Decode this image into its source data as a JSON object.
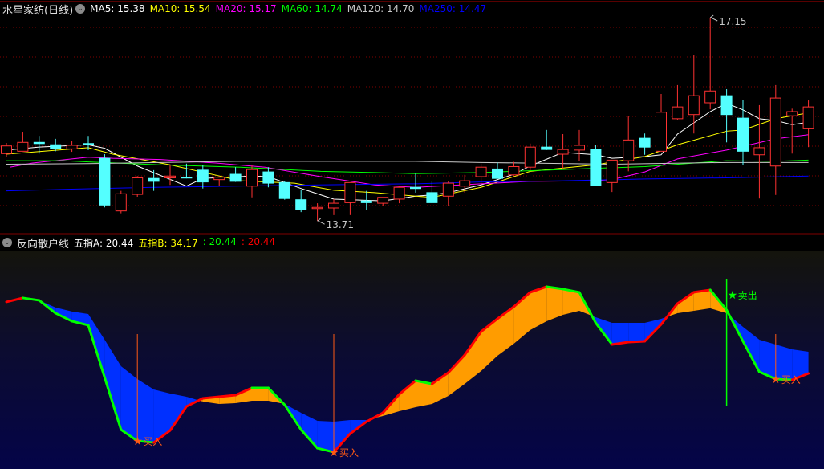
{
  "main_header": {
    "stock_name": "水星家纺(日线)",
    "menu_icon": "chevron-down-circle-icon",
    "ma": [
      {
        "label": "MA5: 15.38",
        "color": "#ffffff"
      },
      {
        "label": "MA10: 15.54",
        "color": "#ffff00"
      },
      {
        "label": "MA20: 15.17",
        "color": "#ff00ff"
      },
      {
        "label": "MA60: 14.74",
        "color": "#00ff00"
      },
      {
        "label": "MA120: 14.70",
        "color": "#c8c8c8"
      },
      {
        "label": "MA250: 14.47",
        "color": "#0000ff"
      }
    ]
  },
  "indicator_header": {
    "menu_icon": "chevron-down-circle-icon",
    "name": "反向散户线",
    "values": [
      {
        "label": "五指A: 20.44",
        "color": "#ffffff"
      },
      {
        "label": "五指B: 34.17",
        "color": "#ffff00"
      },
      {
        "label": ": 20.44",
        "color": "#00ff00"
      },
      {
        "label": ": 20.44",
        "color": "#ff0000"
      }
    ]
  },
  "colors": {
    "up": "#ff3232",
    "down": "#54ffff",
    "grid": "#800000",
    "bull_fill": "#ff9c00",
    "bear_fill": "#0030ff",
    "buy": "#ff5a14",
    "sell": "#00ff00"
  },
  "chart_data": [
    {
      "type": "candlestick",
      "title": "水星家纺(日线)",
      "ohlc": [
        [
          14.85,
          15.03,
          14.8,
          14.98
        ],
        [
          14.89,
          15.22,
          14.89,
          15.04
        ],
        [
          15.04,
          15.15,
          14.85,
          15.02
        ],
        [
          15.0,
          15.1,
          14.89,
          14.93
        ],
        [
          14.93,
          15.06,
          14.88,
          14.99
        ],
        [
          15.02,
          15.15,
          14.91,
          15.0
        ],
        [
          14.77,
          14.84,
          13.94,
          13.98
        ],
        [
          13.88,
          14.22,
          13.84,
          14.17
        ],
        [
          14.16,
          14.47,
          14.12,
          14.44
        ],
        [
          14.43,
          14.57,
          14.22,
          14.38
        ],
        [
          14.44,
          14.65,
          14.32,
          14.47
        ],
        [
          14.45,
          14.68,
          14.43,
          14.44
        ],
        [
          14.57,
          14.66,
          14.26,
          14.37
        ],
        [
          14.41,
          14.47,
          14.31,
          14.45
        ],
        [
          14.5,
          14.62,
          14.37,
          14.38
        ],
        [
          14.3,
          14.65,
          14.11,
          14.58
        ],
        [
          14.54,
          14.62,
          14.28,
          14.35
        ],
        [
          14.36,
          14.39,
          14.07,
          14.09
        ],
        [
          14.07,
          14.23,
          13.86,
          13.9
        ],
        [
          13.92,
          14.01,
          13.71,
          13.94
        ],
        [
          13.93,
          14.08,
          13.81,
          14.01
        ],
        [
          14.02,
          14.36,
          13.81,
          14.36
        ],
        [
          14.05,
          14.22,
          13.89,
          14.02
        ],
        [
          14.01,
          14.11,
          13.96,
          14.11
        ],
        [
          14.08,
          14.3,
          14.01,
          14.28
        ],
        [
          14.28,
          14.51,
          14.19,
          14.26
        ],
        [
          14.19,
          14.39,
          14.01,
          14.02
        ],
        [
          14.13,
          14.39,
          13.96,
          14.35
        ],
        [
          14.3,
          14.49,
          14.19,
          14.39
        ],
        [
          14.46,
          14.68,
          14.31,
          14.62
        ],
        [
          14.59,
          14.7,
          14.43,
          14.43
        ],
        [
          14.49,
          14.71,
          14.48,
          14.63
        ],
        [
          14.62,
          15.02,
          14.57,
          14.96
        ],
        [
          14.96,
          15.25,
          14.91,
          14.92
        ],
        [
          14.84,
          15.18,
          14.6,
          14.92
        ],
        [
          14.91,
          15.25,
          14.73,
          14.99
        ],
        [
          14.92,
          15.0,
          14.31,
          14.31
        ],
        [
          14.36,
          14.74,
          14.2,
          14.74
        ],
        [
          14.73,
          15.48,
          14.55,
          15.08
        ],
        [
          15.11,
          15.19,
          14.83,
          14.96
        ],
        [
          14.89,
          15.86,
          14.89,
          15.55
        ],
        [
          15.44,
          16.01,
          15.42,
          15.64
        ],
        [
          15.51,
          16.52,
          15.19,
          15.83
        ],
        [
          15.71,
          17.15,
          15.6,
          15.91
        ],
        [
          15.83,
          15.94,
          15.04,
          15.51
        ],
        [
          15.45,
          15.75,
          14.66,
          14.89
        ],
        [
          14.83,
          15.67,
          14.09,
          14.95
        ],
        [
          14.64,
          16.01,
          14.15,
          15.79
        ],
        [
          15.49,
          15.61,
          14.85,
          15.56
        ],
        [
          15.27,
          15.75,
          14.96,
          15.64
        ]
      ],
      "ma_series": [
        {
          "name": "MA5",
          "color": "#ffffff",
          "points": [
            [
              1,
              14.91
            ],
            [
              3,
              14.96
            ],
            [
              6,
              15.0
            ],
            [
              7,
              14.94
            ],
            [
              9,
              14.64
            ],
            [
              12,
              14.3
            ],
            [
              13,
              14.43
            ],
            [
              16,
              14.47
            ],
            [
              17,
              14.46
            ],
            [
              19,
              14.26
            ],
            [
              21,
              14.08
            ],
            [
              24,
              14.05
            ],
            [
              26,
              14.13
            ],
            [
              27,
              14.15
            ],
            [
              28,
              14.19
            ],
            [
              30,
              14.32
            ],
            [
              32,
              14.5
            ],
            [
              33,
              14.64
            ],
            [
              35,
              14.87
            ],
            [
              37,
              14.83
            ],
            [
              38,
              14.77
            ],
            [
              40,
              14.8
            ],
            [
              41,
              14.83
            ],
            [
              42,
              15.18
            ],
            [
              43,
              15.37
            ],
            [
              44,
              15.56
            ],
            [
              45,
              15.7
            ],
            [
              46,
              15.59
            ],
            [
              47,
              15.44
            ],
            [
              48,
              15.41
            ],
            [
              49,
              15.34
            ],
            [
              50,
              15.38
            ]
          ]
        },
        {
          "name": "MA10",
          "color": "#ffff00",
          "points": [
            [
              1,
              14.84
            ],
            [
              6,
              14.95
            ],
            [
              7.5,
              14.84
            ],
            [
              11,
              14.66
            ],
            [
              15.3,
              14.39
            ],
            [
              18.6,
              14.35
            ],
            [
              21,
              14.23
            ],
            [
              23.5,
              14.19
            ],
            [
              26,
              14.13
            ],
            [
              27,
              14.11
            ],
            [
              30,
              14.28
            ],
            [
              33,
              14.55
            ],
            [
              37,
              14.66
            ],
            [
              40,
              14.8
            ],
            [
              42,
              15.0
            ],
            [
              45,
              15.23
            ],
            [
              46,
              15.25
            ],
            [
              48,
              15.44
            ],
            [
              50,
              15.54
            ]
          ]
        },
        {
          "name": "MA20",
          "color": "#ff00ff",
          "points": [
            [
              1.2,
              14.62
            ],
            [
              2.6,
              14.69
            ],
            [
              6,
              14.79
            ],
            [
              7.5,
              14.77
            ],
            [
              10.4,
              14.75
            ],
            [
              13.8,
              14.69
            ],
            [
              16.8,
              14.62
            ],
            [
              20.2,
              14.46
            ],
            [
              23.5,
              14.32
            ],
            [
              26,
              14.28
            ],
            [
              30,
              14.34
            ],
            [
              33,
              14.38
            ],
            [
              37,
              14.39
            ],
            [
              38,
              14.41
            ],
            [
              40,
              14.54
            ],
            [
              42,
              14.76
            ],
            [
              45,
              14.91
            ],
            [
              48,
              15.1
            ],
            [
              50,
              15.17
            ]
          ]
        },
        {
          "name": "MA60",
          "color": "#00ff00",
          "points": [
            [
              1,
              14.73
            ],
            [
              4.5,
              14.73
            ],
            [
              6,
              14.71
            ],
            [
              10.4,
              14.66
            ],
            [
              15.3,
              14.62
            ],
            [
              20.2,
              14.55
            ],
            [
              23.5,
              14.53
            ],
            [
              26,
              14.51
            ],
            [
              30,
              14.53
            ],
            [
              34,
              14.57
            ],
            [
              40,
              14.63
            ],
            [
              45,
              14.73
            ],
            [
              48,
              14.72
            ],
            [
              50,
              14.74
            ]
          ]
        },
        {
          "name": "MA120",
          "color": "#c8c8c8",
          "points": [
            [
              1,
              14.67
            ],
            [
              6,
              14.68
            ],
            [
              15,
              14.72
            ],
            [
              26,
              14.72
            ],
            [
              30,
              14.7
            ],
            [
              38,
              14.67
            ],
            [
              45,
              14.7
            ],
            [
              50,
              14.7
            ]
          ]
        },
        {
          "name": "MA250",
          "color": "#0000ff",
          "points": [
            [
              1,
              14.22
            ],
            [
              5,
              14.25
            ],
            [
              10,
              14.28
            ],
            [
              15,
              14.3
            ],
            [
              20,
              14.32
            ],
            [
              26,
              14.34
            ],
            [
              30,
              14.37
            ],
            [
              35,
              14.39
            ],
            [
              40,
              14.42
            ],
            [
              45,
              14.44
            ],
            [
              50,
              14.47
            ]
          ]
        }
      ],
      "annotations": [
        {
          "label": "17.15",
          "candle": 44,
          "price": 17.15,
          "kind": "high"
        },
        {
          "label": "13.71",
          "candle": 20,
          "price": 13.71,
          "kind": "low"
        }
      ]
    },
    {
      "type": "area",
      "title": "反向散户线",
      "series": [
        {
          "name": "五指A",
          "values": [
            65.65,
            68.19,
            66.67,
            58.54,
            53.46,
            50.92,
            17.9,
            -15.12,
            -22.23,
            -23.25,
            -15.63,
            -0.39,
            4.69,
            5.71,
            6.72,
            11.3,
            11.3,
            0.63,
            -15.12,
            -26.8,
            -29.34,
            -17.66,
            -10.04,
            -4.45,
            7.23,
            15.87,
            13.84,
            20.95,
            32.12,
            46.86,
            54.98,
            62.6,
            71.75,
            75.3,
            73.78,
            71.75,
            52.44,
            38.73,
            40.25,
            40.76,
            51.43,
            64.64,
            71.75,
            73.27,
            60.57,
            40.76,
            21.46,
            16.88,
            16.38,
            20.44
          ]
        },
        {
          "name": "五指B",
          "values": [
            65.65,
            67.68,
            66.67,
            62.1,
            59.56,
            58.03,
            41.78,
            25.01,
            16.88,
            10.28,
            7.74,
            5.71,
            2.66,
            1.14,
            1.64,
            3.17,
            3.17,
            1.14,
            -4.45,
            -9.53,
            -10.04,
            -9.02,
            -9.02,
            -6.48,
            -3.44,
            -0.9,
            1.14,
            6.22,
            13.84,
            21.96,
            31.62,
            39.24,
            47.87,
            53.46,
            57.52,
            60.06,
            56.0,
            52.44,
            52.44,
            52.44,
            54.98,
            58.54,
            60.06,
            61.59,
            58.54,
            49.9,
            41.78,
            38.73,
            35.68,
            34.17
          ]
        }
      ],
      "signals": [
        {
          "candle": 9,
          "label": "买入",
          "type": "buy"
        },
        {
          "candle": 21,
          "label": "买入",
          "type": "buy"
        },
        {
          "candle": 45,
          "label": "卖出",
          "type": "sell"
        },
        {
          "candle": 48,
          "label": "买入",
          "type": "buy"
        }
      ]
    }
  ]
}
